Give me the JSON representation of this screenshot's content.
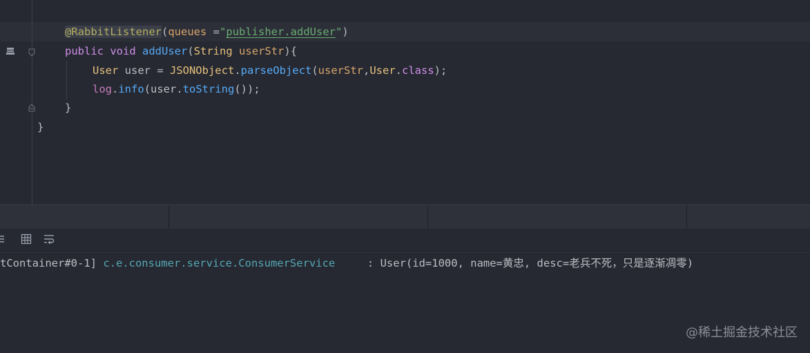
{
  "editor": {
    "lines": {
      "annotation_at": "@",
      "annotation_name": "RabbitListener",
      "annotation_open": "(",
      "annotation_param": "queues",
      "annotation_eq": " =",
      "annotation_q1": "\"",
      "annotation_value": "publisher.addUser",
      "annotation_q2": "\"",
      "annotation_close": ")",
      "kw_public": "public",
      "kw_void": "void",
      "method_name": "addUser",
      "sig_open": "(",
      "param_type": "String",
      "param_name": "userStr",
      "sig_close": "){",
      "var_type": "User",
      "var_name": " user = ",
      "class_json": "JSONObject",
      "dot1": ".",
      "call_parse": "parseObject",
      "args_open": "(",
      "arg_userstr": "userStr",
      "comma": ",",
      "arg_user": "User",
      "dot2": ".",
      "kw_class": "class",
      "args_close": ");",
      "log_obj": "log",
      "dot3": ".",
      "log_info": "info",
      "log_open": "(user.",
      "log_tostring": "toString",
      "log_close": "());",
      "close_method": "}",
      "close_class": "}"
    }
  },
  "toolbar": {
    "left_cut_icon": "list-icon",
    "table_icon": "table-icon",
    "soft-wrap_icon": "soft-wrap-icon"
  },
  "console": {
    "thread": "tContainer#0-1] ",
    "logger": "c.e.consumer.service.ConsumerService",
    "message": "     : User(id=1000, name=黄忠, desc=老兵不死，只是逐渐凋零)"
  },
  "watermark": "@稀土掘金技术社区",
  "colors": {
    "background": "#262932",
    "annotation": "#b3ae60",
    "keyword": "#cf8ee8",
    "function": "#57aaf7",
    "string": "#6aab73",
    "logger": "#56a8b5"
  }
}
